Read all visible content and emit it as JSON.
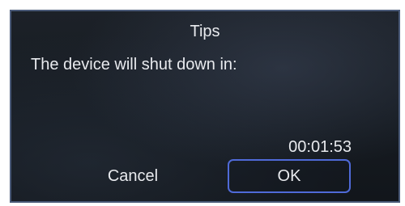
{
  "dialog": {
    "title": "Tips",
    "message": "The device will shut down in:",
    "countdown": "00:01:53",
    "buttons": {
      "cancel_label": "Cancel",
      "ok_label": "OK"
    }
  },
  "colors": {
    "dialog_background": "#161b21",
    "dialog_border": "#4a5a78",
    "text": "#e8eaee",
    "focus_border": "#4f6ad8"
  }
}
